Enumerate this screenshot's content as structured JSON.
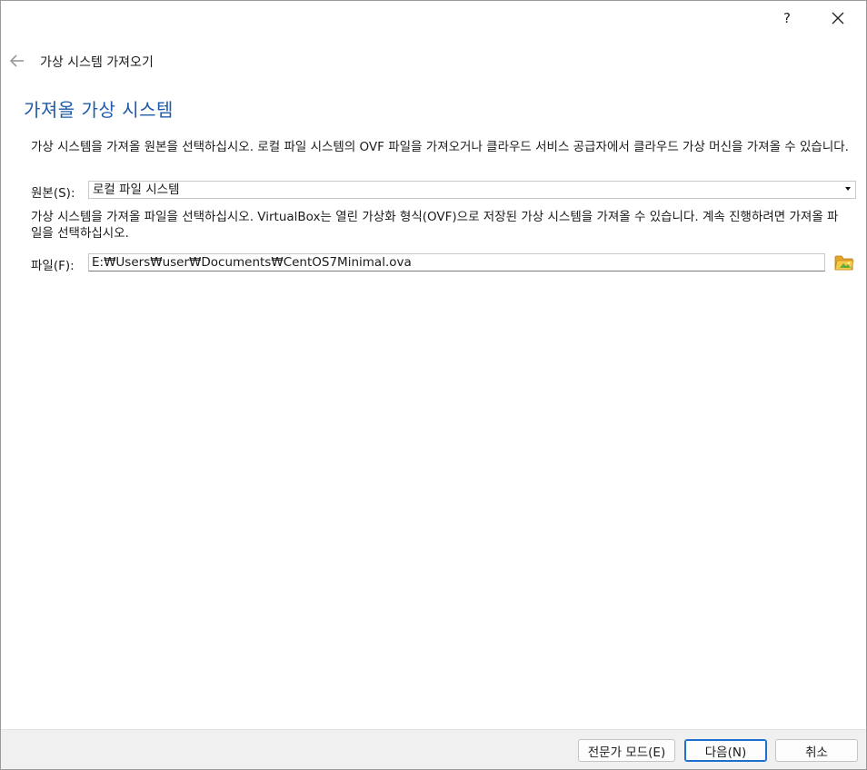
{
  "titlebar": {
    "help_label": "?",
    "close_icon": "close-icon"
  },
  "nav": {
    "back_icon": "back-arrow-icon",
    "wizard_title": "가상 시스템 가져오기"
  },
  "page": {
    "heading": "가져올 가상 시스템",
    "source_description": "가상 시스템을 가져올 원본을 선택하십시오. 로컬 파일 시스템의 OVF 파일을 가져오거나 클라우드 서비스 공급자에서 클라우드 가상 머신을 가져올 수 있습니다.",
    "source_label": "원본(S):",
    "source_selected": "로컬 파일 시스템",
    "file_description": "가상 시스템을 가져올 파일을 선택하십시오. VirtualBox는 열린 가상화 형식(OVF)으로 저장된 가상 시스템을 가져올 수 있습니다. 계속 진행하려면 가져올 파일을 선택하십시오.",
    "file_label": "파일(F):",
    "file_value": "E:₩Users₩user₩Documents₩CentOS7Minimal.ova",
    "folder_icon": "folder-open-icon"
  },
  "footer": {
    "expert_label": "전문가 모드(E)",
    "next_label": "다음(N)",
    "cancel_label": "취소"
  },
  "colors": {
    "heading": "#1f5aa8",
    "default_button_border": "#1f6fd1",
    "footer_bg": "#f0f0f0"
  }
}
